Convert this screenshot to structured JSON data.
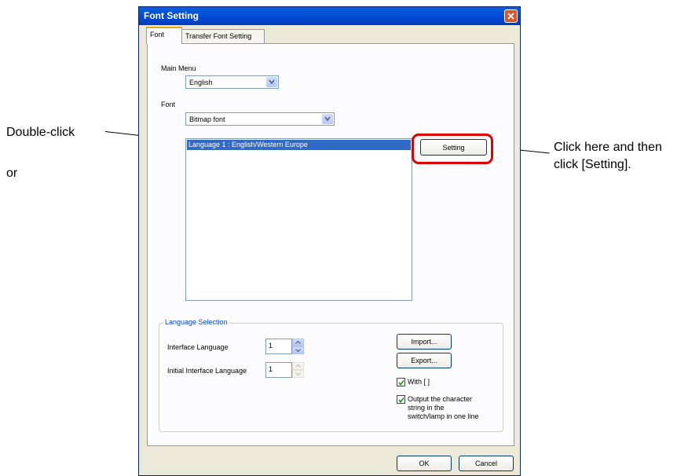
{
  "annotations": {
    "double_click": "Double-click",
    "or": "or",
    "click_here_line1": "Click here and then",
    "click_here_line2": "click [Setting]."
  },
  "dialog": {
    "title": "Font Setting",
    "tabs": [
      "Font",
      "Transfer Font Setting"
    ],
    "main_menu_label": "Main Menu",
    "main_menu_value": "English",
    "font_label": "Font",
    "font_value": "Bitmap font",
    "languages": [
      "Language 1 : English/Western Europe"
    ],
    "setting_button": "Setting",
    "language_selection": {
      "title": "Language Selection",
      "interface_language_label": "Interface Language",
      "interface_language_value": "1",
      "initial_interface_language_label": "Initial Interface Language",
      "initial_interface_language_value": "1",
      "import_button": "Import...",
      "export_button": "Export...",
      "with_brackets_label": "With [ ]",
      "with_brackets_checked": true,
      "output_one_line_label_1": "Output the character",
      "output_one_line_label_2": "string in the",
      "output_one_line_label_3": "switch/lamp in one line",
      "output_one_line_checked": true
    },
    "ok_button": "OK",
    "cancel_button": "Cancel"
  },
  "colors": {
    "title_bar": "#0054e3",
    "selection": "#316ac5",
    "highlight_ring": "#e00000"
  }
}
